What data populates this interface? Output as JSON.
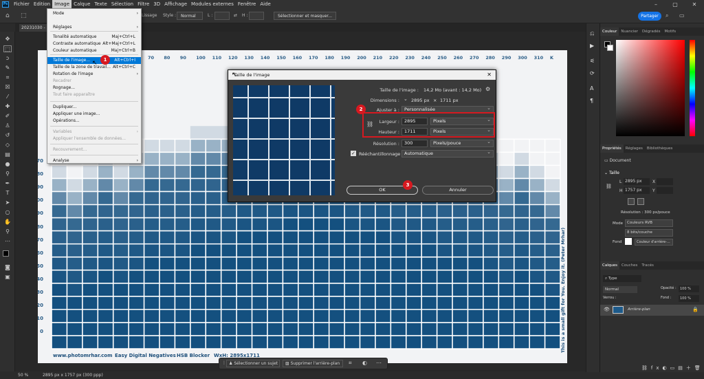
{
  "app": {
    "logo": "Ps",
    "menu": [
      "Fichier",
      "Edition",
      "Image",
      "Calque",
      "Texte",
      "Sélection",
      "Filtre",
      "3D",
      "Affichage",
      "Modules externes",
      "Fenêtre",
      "Aide"
    ],
    "active_menu": "Image"
  },
  "options_bar": {
    "lissage": "Lissage",
    "style_label": "Style :",
    "style_value": "Normal",
    "l_label": "L :",
    "h_label": "H :",
    "select_mask": "Sélectionner et masquer...",
    "share": "Partager"
  },
  "document_tab": {
    "name": "20231030 - Sc"
  },
  "image_menu": {
    "items": [
      {
        "label": "Mode",
        "shortcut": "",
        "submenu": true,
        "disabled": false
      },
      {
        "label": "Réglages",
        "shortcut": "",
        "submenu": true,
        "disabled": false
      },
      {
        "label": "Tonalité automatique",
        "shortcut": "Maj+Ctrl+L",
        "submenu": false,
        "disabled": false
      },
      {
        "label": "Contraste automatique",
        "shortcut": "Alt+Maj+Ctrl+L",
        "submenu": false,
        "disabled": false
      },
      {
        "label": "Couleur automatique",
        "shortcut": "Maj+Ctrl+B",
        "submenu": false,
        "disabled": false
      },
      {
        "label": "Taille de l'image...",
        "shortcut": "Alt+Ctrl+I",
        "submenu": false,
        "disabled": false,
        "highlight": true
      },
      {
        "label": "Taille de la zone de travail...",
        "shortcut": "Alt+Ctrl+C",
        "submenu": false,
        "disabled": false
      },
      {
        "label": "Rotation de l'image",
        "shortcut": "",
        "submenu": true,
        "disabled": false
      },
      {
        "label": "Recadrer",
        "shortcut": "",
        "submenu": false,
        "disabled": true
      },
      {
        "label": "Rognage...",
        "shortcut": "",
        "submenu": false,
        "disabled": false
      },
      {
        "label": "Tout faire apparaître",
        "shortcut": "",
        "submenu": false,
        "disabled": true
      },
      {
        "label": "Dupliquer...",
        "shortcut": "",
        "submenu": false,
        "disabled": false
      },
      {
        "label": "Appliquer une image...",
        "shortcut": "",
        "submenu": false,
        "disabled": false
      },
      {
        "label": "Opérations...",
        "shortcut": "",
        "submenu": false,
        "disabled": false
      },
      {
        "label": "Variables",
        "shortcut": "",
        "submenu": true,
        "disabled": true
      },
      {
        "label": "Appliquer l'ensemble de données...",
        "shortcut": "",
        "submenu": false,
        "disabled": true
      },
      {
        "label": "Recouvrement...",
        "shortcut": "",
        "submenu": false,
        "disabled": true
      },
      {
        "label": "Analyse",
        "shortcut": "",
        "submenu": true,
        "disabled": false
      }
    ]
  },
  "badges": [
    "1",
    "2",
    "3"
  ],
  "dialog": {
    "title": "Taille de l'image",
    "image_size_label": "Taille de l'image :",
    "image_size_value": "14,2 Mo (avant : 14,2 Mo)",
    "dimensions_label": "Dimensions :",
    "dim_w": "2895 px",
    "dim_x": "×",
    "dim_h": "1711 px",
    "fit_label": "Ajuster à :",
    "fit_value": "Personnalisée",
    "width_label": "Largeur :",
    "width_value": "2895",
    "width_unit": "Pixels",
    "height_label": "Hauteur :",
    "height_value": "1711",
    "height_unit": "Pixels",
    "resolution_label": "Résolution :",
    "resolution_value": "300",
    "resolution_unit": "Pixels/pouce",
    "resample_label": "Rééchantillonnage :",
    "resample_value": "Automatique",
    "ok": "OK",
    "cancel": "Annuler"
  },
  "document": {
    "top_numbers": [
      "70",
      "80",
      "90",
      "100",
      "110",
      "120",
      "130",
      "140",
      "150",
      "160",
      "170",
      "180",
      "190",
      "200",
      "210",
      "220",
      "230",
      "240",
      "250",
      "260",
      "270",
      "280",
      "290",
      "300",
      "310",
      "K"
    ],
    "left_numbers": [
      "70",
      "80",
      "90",
      "100",
      "90",
      "80",
      "70",
      "60",
      "50",
      "40",
      "30",
      "20",
      "10",
      "0"
    ],
    "footer": [
      "www.photomrhar.com",
      "Easy Digital Negatives",
      "HSB Blocker",
      "WxH: 2895x1711"
    ],
    "side_text": "This is a small gift for You. Enjoy it. (Peter Mrhar)"
  },
  "status": {
    "zoom": "50 %",
    "info": "2895 px x 1757 px (300 ppp)"
  },
  "taskbar": {
    "select_subject": "Sélectionner un sujet",
    "remove_bg": "Supprimer l'arrière-plan"
  },
  "color_panel": {
    "tabs": [
      "Couleur",
      "Nuancier",
      "Dégradés",
      "Motifs"
    ],
    "fg": "#000000",
    "bg": "#ffffff"
  },
  "properties_panel": {
    "tabs": [
      "Propriétés",
      "Réglages",
      "Bibliothèques"
    ],
    "doc": "Document",
    "section": "Taille",
    "w_label": "L",
    "w_value": "2895 px",
    "x_label": "X",
    "h_label": "H",
    "h_value": "1757 px",
    "y_label": "Y",
    "resolution": "Résolution : 300 px/pouce",
    "mode_label": "Mode",
    "mode_value": "Couleurs RVB",
    "depth": "8 bits/couche",
    "fond_label": "Fond",
    "fond_value": "Couleur d'arrière-..."
  },
  "layers_panel": {
    "tabs": [
      "Calques",
      "Couches",
      "Tracés"
    ],
    "search": "Type",
    "blend": "Normal",
    "opacity_label": "Opacité :",
    "opacity_value": "100 %",
    "lock_label": "Verrou :",
    "fill_label": "Fond :",
    "fill_value": "100 %",
    "layer_name": "Arrière-plan"
  }
}
